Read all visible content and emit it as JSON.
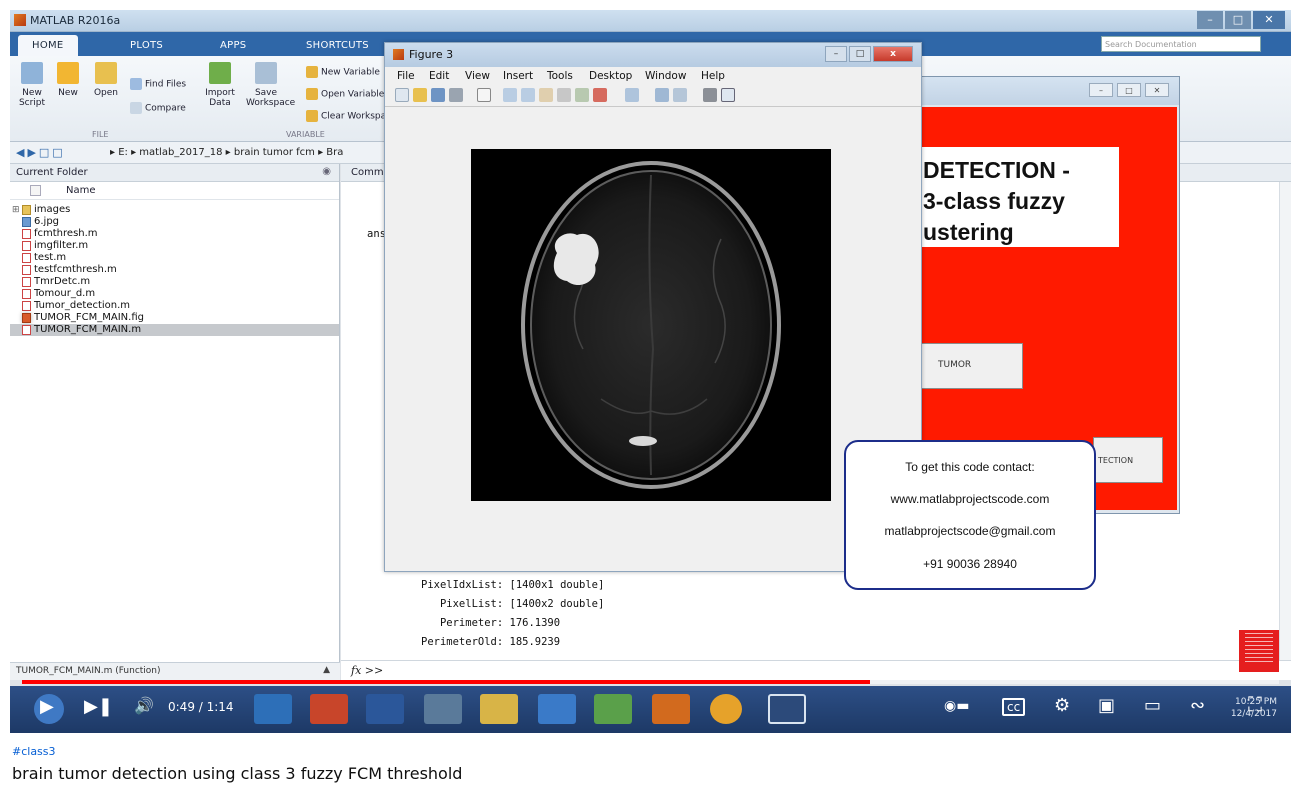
{
  "matlab": {
    "title": "MATLAB R2016a",
    "tabs": [
      "HOME",
      "PLOTS",
      "APPS",
      "SHORTCUTS"
    ],
    "search_placeholder": "Search Documentation",
    "ribbon": {
      "new_script": "New Script",
      "new": "New",
      "open": "Open",
      "find_files": "Find Files",
      "compare": "Compare",
      "import_data": "Import Data",
      "save_workspace": "Save Workspace",
      "new_variable": "New Variable",
      "open_variable": "Open Variable",
      "clear_workspace": "Clear Workspace",
      "group_file": "FILE",
      "group_variable": "VARIABLE"
    },
    "breadcrumbs": "▸ E: ▸ matlab_2017_18 ▸ brain tumor fcm ▸ Bra",
    "current_folder": {
      "header": "Current Folder",
      "column_name": "Name",
      "files": [
        {
          "name": "images",
          "kind": "folder"
        },
        {
          "name": "6.jpg",
          "kind": "img"
        },
        {
          "name": "fcmthresh.m",
          "kind": "m"
        },
        {
          "name": "imgfilter.m",
          "kind": "m"
        },
        {
          "name": "test.m",
          "kind": "m"
        },
        {
          "name": "testfcmthresh.m",
          "kind": "m"
        },
        {
          "name": "TmrDetc.m",
          "kind": "m"
        },
        {
          "name": "Tomour_d.m",
          "kind": "m"
        },
        {
          "name": "Tumor_detection.m",
          "kind": "m"
        },
        {
          "name": "TUMOR_FCM_MAIN.fig",
          "kind": "fig"
        },
        {
          "name": "TUMOR_FCM_MAIN.m",
          "kind": "m"
        }
      ],
      "details": "TUMOR_FCM_MAIN.m (Function)"
    },
    "command_window": {
      "header": "Comma",
      "ans": "ans",
      "lines": [
        "PixelIdxList: [1400x1 double]",
        "   PixelList: [1400x2 double]",
        "   Perimeter: 176.1390",
        "PerimeterOld: 185.9239"
      ],
      "prompt": "fx >>"
    }
  },
  "figure": {
    "title": "Figure 3",
    "menu": [
      "File",
      "Edit",
      "View",
      "Insert",
      "Tools",
      "Desktop",
      "Window",
      "Help"
    ],
    "close": "x"
  },
  "gui": {
    "heading": [
      "DETECTION -",
      "3-class fuzzy",
      "ustering"
    ],
    "tumor_button": "TUMOR",
    "detection_button": "TECTION"
  },
  "contact": {
    "line1": "To get this code contact:",
    "line2": "www.matlabprojectscode.com",
    "line3": "matlabprojectscode@gmail.com",
    "line4": "+91 90036 28940"
  },
  "player": {
    "time": "0:49 / 1:14",
    "progress": 0.675,
    "clock_time": "10:25 PM",
    "clock_date": "12/4/2017"
  },
  "video": {
    "hashtag": "#class3",
    "title": "brain tumor detection using class 3 fuzzy FCM threshold"
  }
}
